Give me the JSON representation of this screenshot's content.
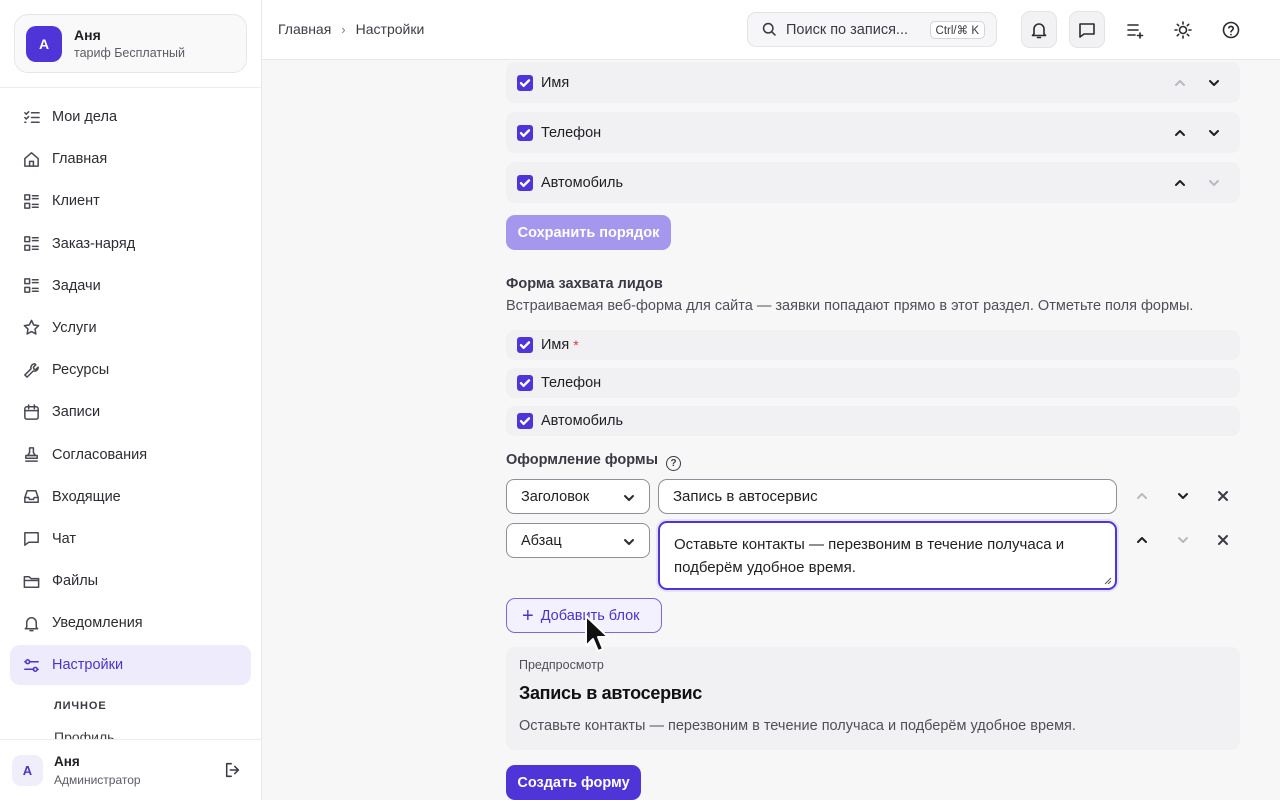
{
  "account": {
    "avatar": "А",
    "name": "Аня",
    "plan": "тариф Бесплатный"
  },
  "nav": [
    {
      "label": "Мои дела",
      "icon": "tasks-list-icon"
    },
    {
      "label": "Главная",
      "icon": "home-icon"
    },
    {
      "label": "Клиент",
      "icon": "list-icon"
    },
    {
      "label": "Заказ-наряд",
      "icon": "list-icon"
    },
    {
      "label": "Задачи",
      "icon": "list-icon"
    },
    {
      "label": "Услуги",
      "icon": "star-icon"
    },
    {
      "label": "Ресурсы",
      "icon": "wrench-icon"
    },
    {
      "label": "Записи",
      "icon": "calendar-icon"
    },
    {
      "label": "Согласования",
      "icon": "stamp-icon"
    },
    {
      "label": "Входящие",
      "icon": "inbox-icon"
    },
    {
      "label": "Чат",
      "icon": "chat-icon"
    },
    {
      "label": "Файлы",
      "icon": "folder-icon"
    },
    {
      "label": "Уведомления",
      "icon": "bell-icon"
    },
    {
      "label": "Настройки",
      "icon": "settings-sliders-icon",
      "active": true
    }
  ],
  "nav_section": "ЛИЧНОЕ",
  "nav_sub_item": "Профиль",
  "user": {
    "avatar": "А",
    "name": "Аня",
    "role": "Администратор"
  },
  "breadcrumb": {
    "home": "Главная",
    "current": "Настройки"
  },
  "search": {
    "placeholder": "Поиск по запися...",
    "shortcut": "Ctrl/⌘ K"
  },
  "order_fields": [
    {
      "label": "Имя",
      "checked": true
    },
    {
      "label": "Телефон",
      "checked": true
    },
    {
      "label": "Автомобиль",
      "checked": true
    }
  ],
  "save_order_label": "Сохранить порядок",
  "lead_form": {
    "title": "Форма захвата лидов",
    "description": "Встраиваемая веб-форма для сайта — заявки попадают прямо в этот раздел. Отметьте поля формы.",
    "fields": [
      {
        "label": "Имя",
        "required_mark": "*",
        "checked": true
      },
      {
        "label": "Телефон",
        "checked": true
      },
      {
        "label": "Автомобиль",
        "checked": true
      }
    ]
  },
  "design": {
    "title": "Оформление формы",
    "blocks": [
      {
        "type": "Заголовок",
        "text": "Запись в автосервис"
      },
      {
        "type": "Абзац",
        "text": "Оставьте контакты — перезвоним в течение получаса и подберём удобное время."
      }
    ],
    "add_block_label": "Добавить блок"
  },
  "preview": {
    "label": "Предпросмотр",
    "title": "Запись в автосервис",
    "text": "Оставьте контакты — перезвоним в течение получаса и подберём удобное время."
  },
  "create_form_label": "Создать форму",
  "colors": {
    "accent": "#4f35d8",
    "accent_light": "#a597ee",
    "active_bg": "#eeebfc"
  }
}
